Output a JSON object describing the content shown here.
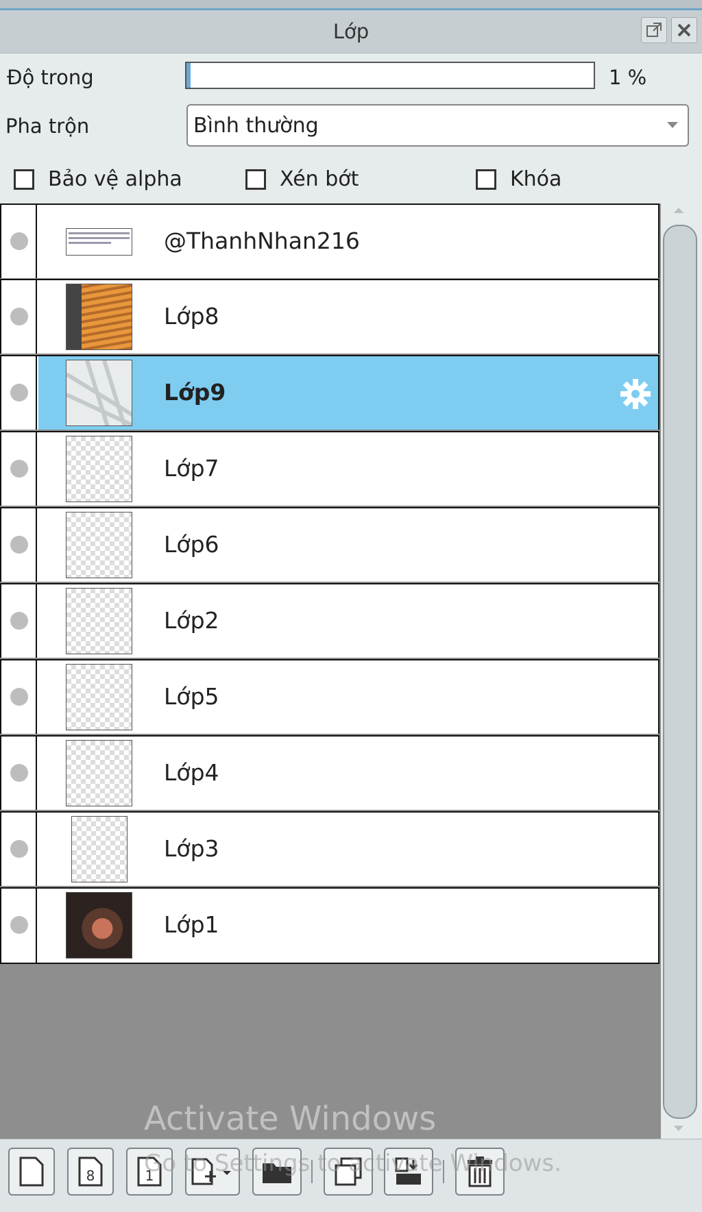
{
  "window": {
    "title": "Lớp"
  },
  "controls": {
    "opacity_label": "Độ trong",
    "opacity_value": "1 %",
    "opacity_fraction": 0.01,
    "blend_label": "Pha trộn",
    "blend_value": "Bình thường"
  },
  "checkboxes": [
    {
      "label": "Bảo vệ alpha",
      "checked": false
    },
    {
      "label": "Xén bớt",
      "checked": false
    },
    {
      "label": "Khóa",
      "checked": false
    }
  ],
  "layers": [
    {
      "name": "@ThanhNhan216",
      "thumb": "text",
      "selected": false
    },
    {
      "name": "Lớp8",
      "thumb": "blinds",
      "selected": false
    },
    {
      "name": "Lớp9",
      "thumb": "lines",
      "selected": true
    },
    {
      "name": "Lớp7",
      "thumb": "checker",
      "selected": false
    },
    {
      "name": "Lớp6",
      "thumb": "checker",
      "selected": false
    },
    {
      "name": "Lớp2",
      "thumb": "checker",
      "selected": false
    },
    {
      "name": "Lớp5",
      "thumb": "checker",
      "selected": false
    },
    {
      "name": "Lớp4",
      "thumb": "checker",
      "selected": false
    },
    {
      "name": "Lớp3",
      "thumb": "checker-narrow",
      "selected": false
    },
    {
      "name": "Lớp1",
      "thumb": "photo",
      "selected": false
    }
  ],
  "watermark": {
    "line1": "Activate Windows",
    "line2": "Go to Settings to activate Windows."
  },
  "toolbar": {
    "buttons": [
      "new-layer-icon",
      "new-8bit-layer-icon",
      "new-1bit-layer-icon",
      "add-layer-menu-icon",
      "new-folder-icon",
      "duplicate-layer-icon",
      "merge-down-icon",
      "delete-layer-icon"
    ],
    "new8_label": "8",
    "new1_label": "1"
  },
  "colors": {
    "selected_row": "#7ecdf1",
    "accent": "#6fa7c7"
  }
}
